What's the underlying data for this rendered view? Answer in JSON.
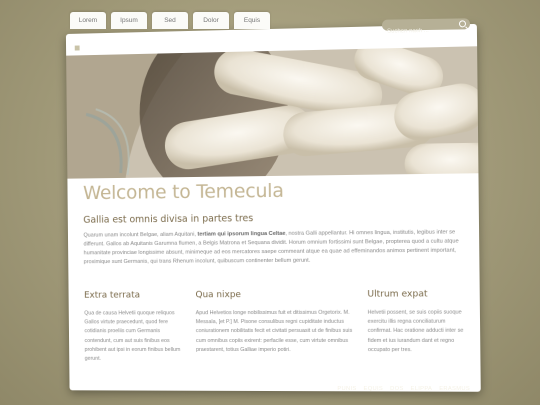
{
  "tabs": [
    "Lorem",
    "Ipsum",
    "Sed",
    "Dolor",
    "Equis"
  ],
  "search": {
    "placeholder": "Suchen nach ..."
  },
  "main": {
    "title": "Welcome to Temecula",
    "subtitle": "Gallia est omnis divisa in partes tres",
    "intro_before_bold": "Quarum unam incolunt Belgae, aliam Aquitani, ",
    "intro_bold": "tertiam qui ipsorum lingua Celtae",
    "intro_after_bold": ", nostra Galli appellantur. Hi omnes lingua, institutis, legibus inter se differunt. Gallos ab Aquitanis Garumna flumen, a Belgis Matrona et Sequana dividit. Horum omnium fortissimi sunt Belgae, propterea quod a cultu atque humanitate provinciae longissime absunt, minimeque ad eos mercatores saepe commeant atque ea quae ad effeminandos animos pertinent important, proximique sunt Germanis, qui trans Rhenum incolunt, quibuscum continenter bellum gerunt."
  },
  "columns": [
    {
      "heading": "Extra terrata",
      "text": "Qua de causa Helvetii quoque reliquos Gallos virtute praecedunt, quod fere cotidianis proeliis cum Germanis contendunt, cum aut suis finibus eos prohibent aut ipsi in eorum finibus bellum gerunt."
    },
    {
      "heading": "Qua nixpe",
      "text": "Apud Helvetios longe nobilissimus fuit et ditissimus Orgetorix. M. Messala, [et P.] M. Pisone consulibus regni cupiditate inductus coniurationem nobilitatis fecit et civitati persuasit ut de finibus suis cum omnibus copiis exirent: perfacile esse, cum virtute omnibus praestarent, totius Galliae imperio potiri."
    },
    {
      "heading": "Ultrum expat",
      "text": "Helvetii possent, se suis copiis suoque exercitu illis regna conciliaturum confirmat. Hac oratione adducti inter se fidem et ius iurandum dant et regno occupato per tres."
    }
  ],
  "footer": [
    "PUNIS",
    "EQUIS",
    "DOS",
    "ELIPPA",
    "ERASMUS"
  ],
  "colors": {
    "accent": "#c4b694",
    "heading": "#7a6a4a",
    "background": "#a39c7b"
  }
}
